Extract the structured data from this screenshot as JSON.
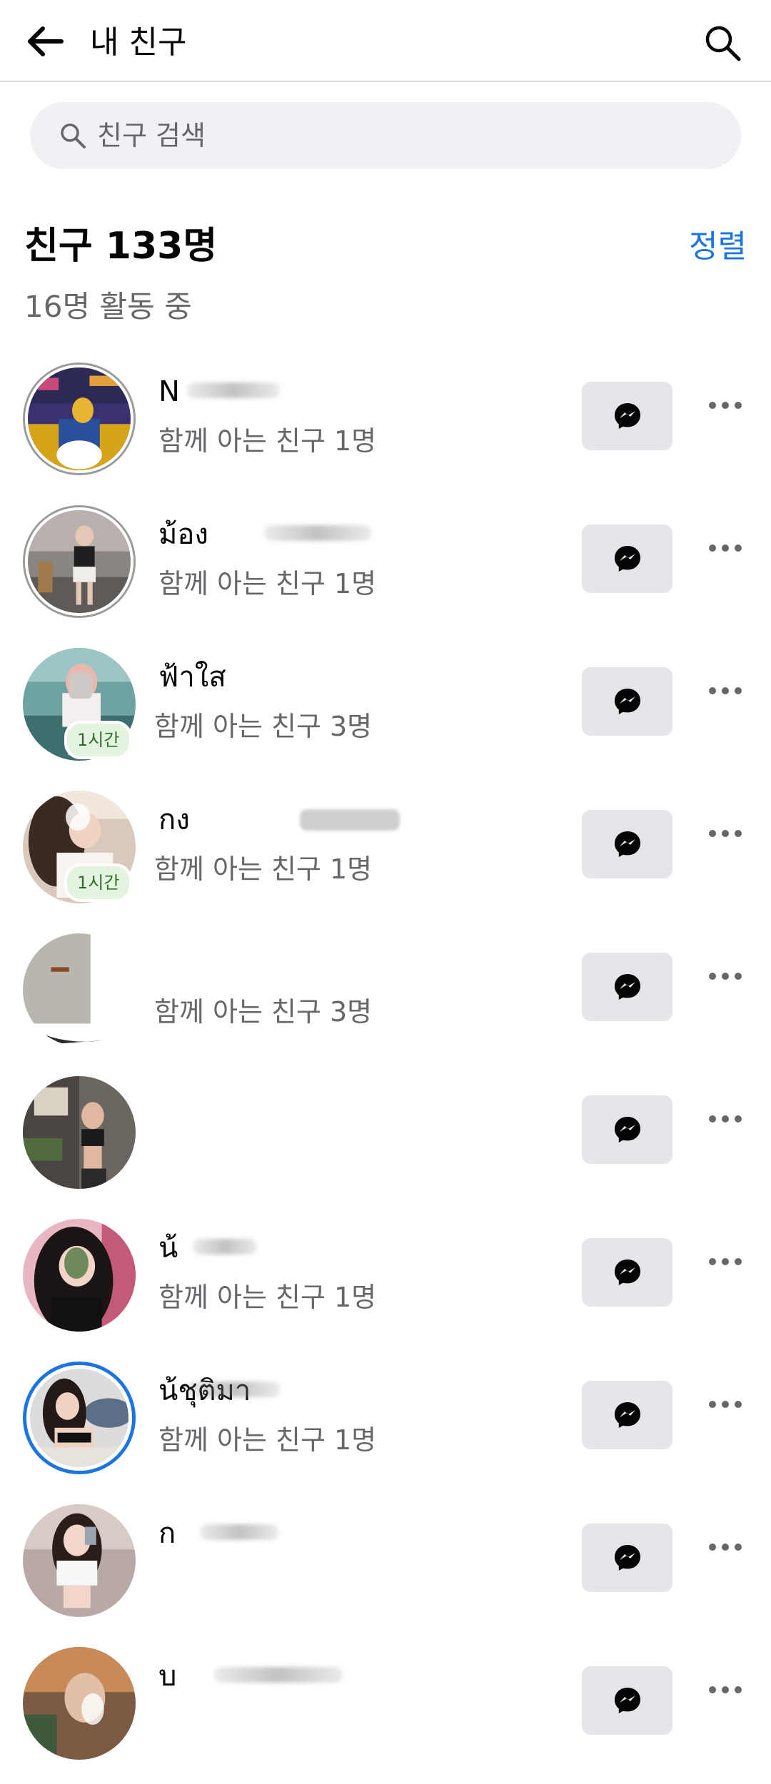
{
  "header": {
    "title": "내 친구",
    "back_icon": "back-arrow-icon",
    "search_icon": "search-icon"
  },
  "search": {
    "placeholder": "친구 검색",
    "value": ""
  },
  "summary": {
    "title": "친구 133명",
    "sort_label": "정렬",
    "active_text": "16명 활동 중"
  },
  "colors": {
    "accent": "#1b74e4",
    "active_badge_bg": "#e4f4e0",
    "active_badge_text": "#2f6f29",
    "secondary_text": "#65676b",
    "button_bg": "#e5e6eb"
  },
  "friends": [
    {
      "name": "N",
      "mutual": "함께 아는 친구 1명",
      "badge": "",
      "ring": "gray"
    },
    {
      "name": "ม้อง",
      "mutual": "함께 아는 친구 1명",
      "badge": "",
      "ring": "gray"
    },
    {
      "name": "ฟ้าใส",
      "mutual": "함께 아는 친구 3명",
      "badge": "1시간",
      "ring": "none"
    },
    {
      "name": "กง",
      "mutual": "함께 아는 친구 1명",
      "badge": "1시간",
      "ring": "none"
    },
    {
      "name": "",
      "mutual": "함께 아는 친구 3명",
      "badge": "",
      "ring": "none"
    },
    {
      "name": "",
      "mutual": "",
      "badge": "",
      "ring": "none"
    },
    {
      "name": "น้",
      "mutual": "함께 아는 친구 1명",
      "badge": "",
      "ring": "none"
    },
    {
      "name": "น้ชุติมา",
      "mutual": "함께 아는 친구 1명",
      "badge": "",
      "ring": "blue"
    },
    {
      "name": "ก",
      "mutual": "",
      "badge": "",
      "ring": "none"
    },
    {
      "name": "บ",
      "mutual": "",
      "badge": "",
      "ring": "none"
    }
  ],
  "row_icons": {
    "message": "messenger-icon",
    "more": "more-options-icon"
  }
}
